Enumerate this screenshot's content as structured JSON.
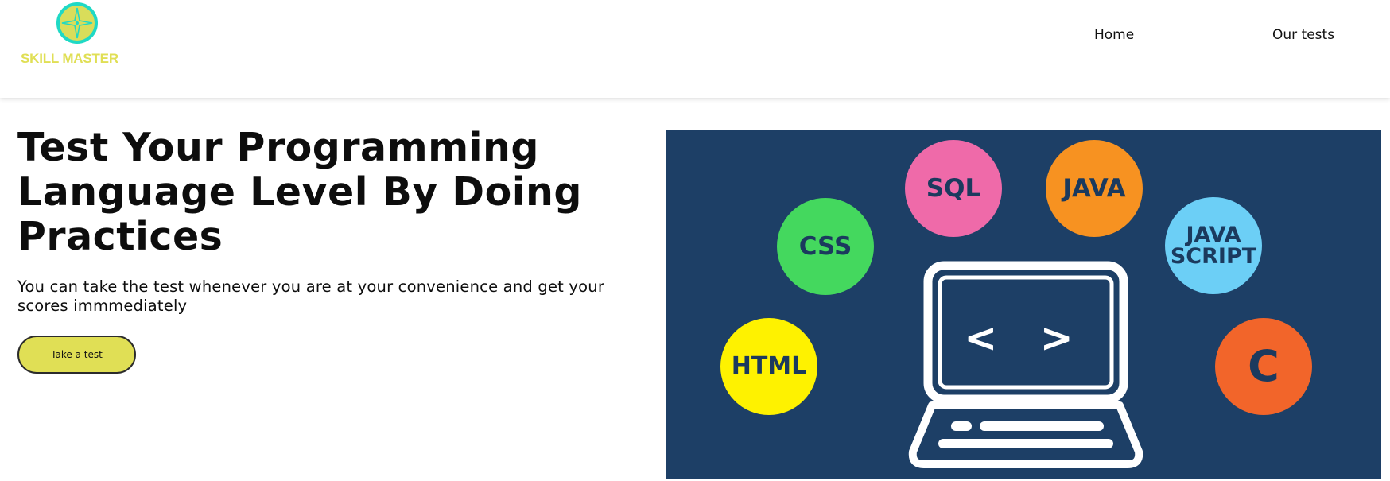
{
  "brand": {
    "name": "SKILL MASTER",
    "text_color": "#e0df55",
    "logo_ring_color": "#1fd9c5",
    "logo_fill_color": "#d9dd5a",
    "logo_icon": "compass-star-icon"
  },
  "nav": {
    "items": [
      {
        "label": "Home"
      },
      {
        "label": "Our tests"
      }
    ]
  },
  "hero": {
    "title": "Test Your Programming Language Level By Doing Practices",
    "subtitle": "You can take the test whenever you are at your convenience and get your scores immmediately",
    "cta_label": "Take a test",
    "cta_color": "#e0df55"
  },
  "illustration": {
    "background": "#1d3f66",
    "laptop_icon": "laptop-code-icon",
    "laptop_code_symbol": "< >",
    "bubbles": [
      {
        "label": "SQL",
        "color": "#ef6aa9"
      },
      {
        "label": "JAVA",
        "color": "#f79221"
      },
      {
        "label": "CSS",
        "color": "#44d85e"
      },
      {
        "label": "JAVA\nSCRIPT",
        "color": "#6ccff6"
      },
      {
        "label": "HTML",
        "color": "#fef200"
      },
      {
        "label": "C",
        "color": "#f2652a"
      }
    ]
  }
}
